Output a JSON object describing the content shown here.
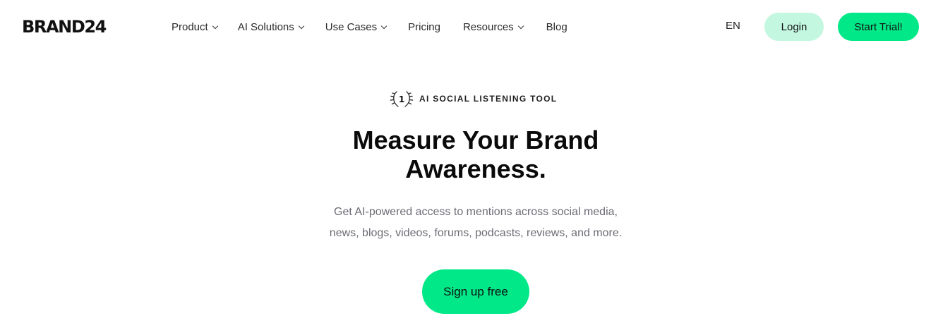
{
  "header": {
    "logo": "BRAND24",
    "nav": [
      {
        "label": "Product",
        "dropdown": true
      },
      {
        "label": "AI Solutions",
        "dropdown": true
      },
      {
        "label": "Use Cases",
        "dropdown": true
      },
      {
        "label": "Pricing",
        "dropdown": false
      },
      {
        "label": "Resources",
        "dropdown": true
      },
      {
        "label": "Blog",
        "dropdown": false
      }
    ],
    "language": "EN",
    "login_label": "Login",
    "trial_label": "Start Trial!"
  },
  "hero": {
    "badge_number": "1",
    "badge_text": "AI SOCIAL LISTENING TOOL",
    "title_line1": "Measure Your Brand",
    "title_line2": "Awareness.",
    "subtitle_line1": "Get AI-powered access to mentions across social media,",
    "subtitle_line2": "news, blogs, videos, forums, podcasts, reviews, and more.",
    "cta_label": "Sign up free"
  },
  "colors": {
    "accent": "#00e887",
    "login_bg": "#c3f7e0",
    "subtitle_text": "#6c6c75"
  },
  "icons": [
    "chevron-down-icon",
    "laurel-wreath-icon"
  ]
}
